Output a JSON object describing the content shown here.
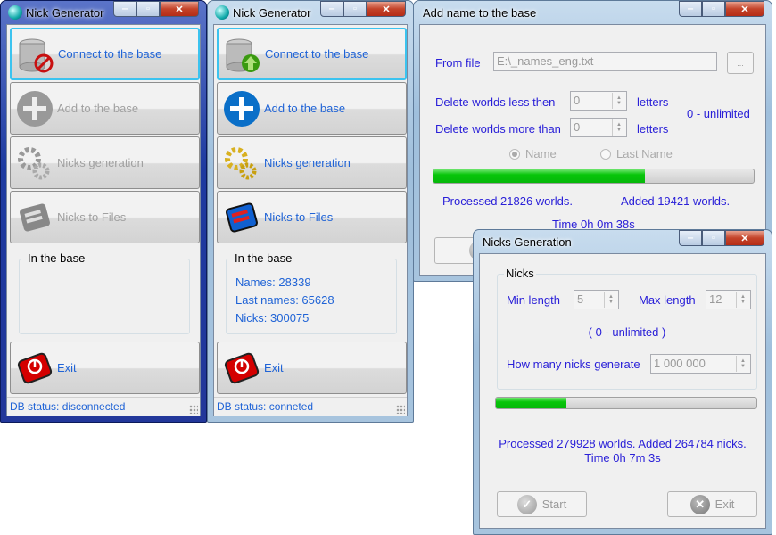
{
  "main_disconnected": {
    "title": "Nick Generator",
    "buttons": [
      "Connect to the base",
      "Add to the base",
      "Nicks generation",
      "Nicks to Files",
      "Exit"
    ],
    "group_label": "In the base",
    "status": "DB status: disconnected"
  },
  "main_connected": {
    "title": "Nick Generator",
    "buttons": [
      "Connect to the base",
      "Add to the base",
      "Nicks generation",
      "Nicks to Files",
      "Exit"
    ],
    "group_label": "In the base",
    "stats": [
      "Names: 28339",
      "Last names: 65628",
      "Nicks: 300075"
    ],
    "status": "DB status: conneted"
  },
  "add_name": {
    "title": "Add name to the base",
    "from_file_label": "From file",
    "file_path": "E:\\_names_eng.txt",
    "browse_label": "...",
    "delete_less_label": "Delete worlds less then",
    "delete_less_value": "0",
    "delete_more_label": "Delete worlds more than",
    "delete_more_value": "0",
    "letters_label": "letters",
    "unlimited_note": "0 - unlimited",
    "radio_name": "Name",
    "radio_last_name": "Last Name",
    "radio_selected": "Name",
    "progress_percent": 66,
    "processed": "Processed 21826 worlds.",
    "added": "Added 19421 worlds.",
    "time": "Time 0h 0m 38s"
  },
  "nicks_generation": {
    "title": "Nicks Generation",
    "group_label": "Nicks",
    "min_length_label": "Min length",
    "min_length_value": "5",
    "max_length_label": "Max length",
    "max_length_value": "12",
    "unlimited_note": "( 0 - unlimited )",
    "count_label": "How many nicks generate",
    "count_value": "1 000 000",
    "progress_percent": 27,
    "result_line": "Processed 279928 worlds. Added 264784 nicks.",
    "time": "Time 0h 7m 3s",
    "start_label": "Start",
    "exit_label": "Exit"
  },
  "colors": {
    "accent_text": "#1f63d6",
    "label_text": "#2a20d8",
    "progress": "#07c50a"
  }
}
